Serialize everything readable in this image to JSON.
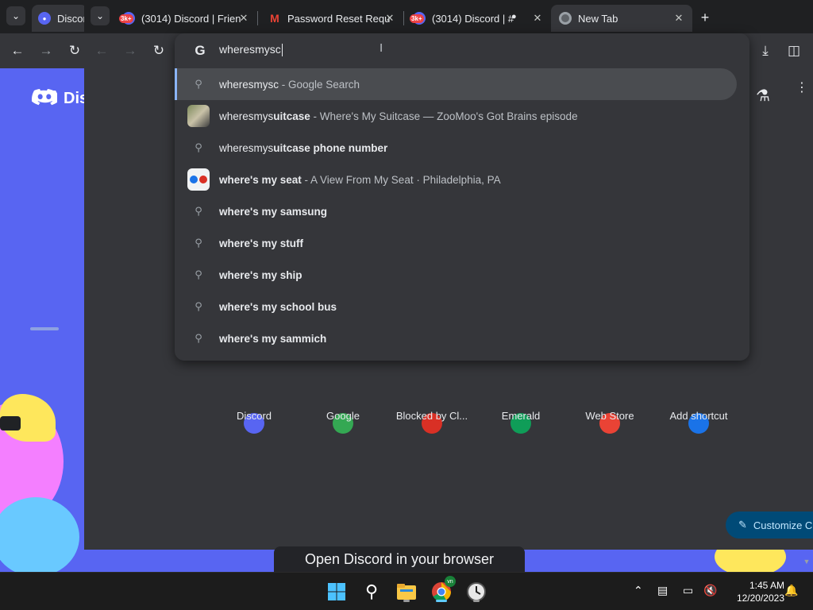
{
  "back_window": {
    "tab1_label": "Discord",
    "logo_text": "Dis",
    "banner_text": "Open Discord in your browser"
  },
  "front_window": {
    "tabs": [
      {
        "label": "(3014) Discord | Frien",
        "badge": "3k+"
      },
      {
        "label": "Password Reset Requ"
      },
      {
        "label": "(3014) Discord | #",
        "badge": "3k+"
      },
      {
        "label": "New Tab"
      }
    ],
    "new_tab_symbol": "+",
    "omnibox": {
      "value": "wheresmysc",
      "logo": "G",
      "suggestions": [
        {
          "main": "wheresmysc",
          "bold": "",
          "desc": " - Google Search",
          "icon": "search-icon",
          "selected": true
        },
        {
          "main": "wheresmys",
          "bold": "uitcase",
          "desc": " - Where's My Suitcase — ZooMoo's Got Brains episode",
          "icon": "raccoon-thumbnail"
        },
        {
          "main": "wheresmys",
          "bold": "uitcase phone number",
          "desc": "",
          "icon": "search-icon"
        },
        {
          "main": "",
          "bold": "where's my seat",
          "desc": " - A View From My Seat · Philadelphia, PA",
          "icon": "binoculars-thumbnail"
        },
        {
          "main": "",
          "bold": "where's my samsung",
          "desc": "",
          "icon": "search-icon"
        },
        {
          "main": "",
          "bold": "where's my stuff",
          "desc": "",
          "icon": "search-icon"
        },
        {
          "main": "",
          "bold": "where's my ship",
          "desc": "",
          "icon": "search-icon"
        },
        {
          "main": "",
          "bold": "where's my school bus",
          "desc": "",
          "icon": "search-icon"
        },
        {
          "main": "",
          "bold": "where's my sammich",
          "desc": "",
          "icon": "search-icon"
        }
      ]
    },
    "shortcuts": [
      {
        "label": "Discord",
        "color": "#5865f2"
      },
      {
        "label": "Google",
        "color": "#34a853"
      },
      {
        "label": "Blocked by Cl...",
        "color": "#d93025"
      },
      {
        "label": "Emerald",
        "color": "#0f9d58"
      },
      {
        "label": "Web Store",
        "color": "#ea4335"
      },
      {
        "label": "Add shortcut",
        "color": "#1a73e8"
      }
    ],
    "customize_label": "Customize C"
  },
  "taskbar": {
    "time": "1:45 AM",
    "date": "12/20/2023",
    "chrome_badge": "vn"
  },
  "colors": {
    "discord_blurple": "#5865f2",
    "chrome_dark": "#35363a",
    "accent_blue": "#8ab4f8"
  }
}
